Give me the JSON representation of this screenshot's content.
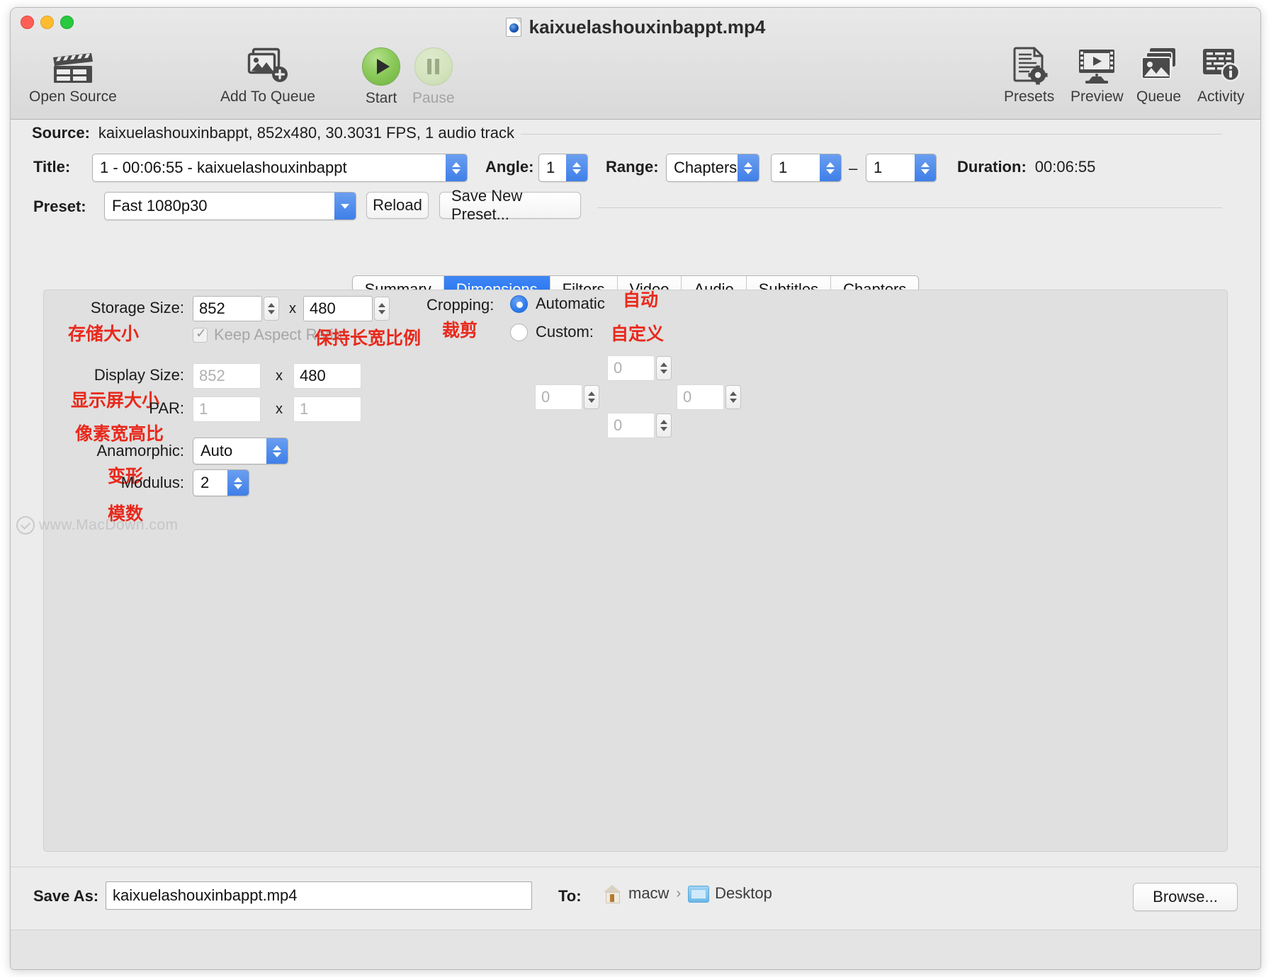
{
  "window": {
    "title": "kaixuelashouxinbappt.mp4",
    "file_icon": "mp4-file-icon",
    "traffic_lights": [
      "close",
      "minimize",
      "zoom"
    ]
  },
  "toolbar": {
    "left_items": [
      {
        "label": "Open Source",
        "icon": "clapperboard-icon"
      },
      {
        "label": "Add To Queue",
        "icon": "add-image-stack-icon"
      },
      {
        "label": "Start",
        "icon": "play-circle-icon"
      },
      {
        "label": "Pause",
        "icon": "pause-circle-icon",
        "disabled": true
      }
    ],
    "right_items": [
      {
        "label": "Presets",
        "icon": "document-gear-icon"
      },
      {
        "label": "Preview",
        "icon": "monitor-play-icon"
      },
      {
        "label": "Queue",
        "icon": "image-stack-icon"
      },
      {
        "label": "Activity",
        "icon": "log-info-icon"
      }
    ]
  },
  "source": {
    "label": "Source:",
    "value": "kaixuelashouxinbappt, 852x480, 30.3031 FPS, 1 audio track"
  },
  "title_row": {
    "label": "Title:",
    "value": "1 - 00:06:55 - kaixuelashouxinbappt",
    "angle_label": "Angle:",
    "angle_value": "1",
    "range_label": "Range:",
    "range_type": "Chapters",
    "range_start": "1",
    "range_dash": "–",
    "range_end": "1",
    "duration_label": "Duration:",
    "duration_value": "00:06:55"
  },
  "preset_row": {
    "label": "Preset:",
    "value": "Fast 1080p30",
    "reload_label": "Reload",
    "save_new_label": "Save New Preset..."
  },
  "tabs": [
    {
      "label": "Summary",
      "active": false
    },
    {
      "label": "Dimensions",
      "active": true
    },
    {
      "label": "Filters",
      "active": false
    },
    {
      "label": "Video",
      "active": false
    },
    {
      "label": "Audio",
      "active": false
    },
    {
      "label": "Subtitles",
      "active": false
    },
    {
      "label": "Chapters",
      "active": false
    }
  ],
  "dimensions": {
    "storage_size": {
      "label": "Storage Size:",
      "label_cn": "存储大小",
      "width": "852",
      "height": "480",
      "sep": "x"
    },
    "keep_aspect": {
      "label": "Keep Aspect Ratio",
      "label_cn": "保持长宽比例",
      "checked": true
    },
    "display_size": {
      "label": "Display Size:",
      "label_cn": "显示屏大小",
      "width": "852",
      "height": "480",
      "sep": "x"
    },
    "par": {
      "label": "PAR:",
      "label_cn": "像素宽高比",
      "width": "1",
      "height": "1",
      "sep": "x"
    },
    "anamorphic": {
      "label": "Anamorphic:",
      "label_cn": "变形",
      "value": "Auto"
    },
    "modulus": {
      "label": "Modulus:",
      "label_cn": "模数",
      "value": "2"
    },
    "cropping": {
      "label": "Cropping:",
      "label_cn": "裁剪",
      "automatic_label": "Automatic",
      "automatic_label_cn": "自动",
      "automatic_selected": true,
      "custom_label": "Custom:",
      "custom_label_cn": "自定义",
      "custom_selected": false,
      "top": "0",
      "left": "0",
      "right": "0",
      "bottom": "0"
    }
  },
  "watermark": {
    "text": "www.MacDown.com"
  },
  "save": {
    "label": "Save As:",
    "filename": "kaixuelashouxinbappt.mp4",
    "to_label": "To:",
    "path_home": "macw",
    "path_sep": "›",
    "path_folder": "Desktop",
    "browse_label": "Browse..."
  },
  "colors": {
    "accent_blue": "#2f7cec",
    "annotation_red": "#e8291c",
    "window_bg": "#ececec",
    "panel_bg": "#e0e0e0"
  }
}
